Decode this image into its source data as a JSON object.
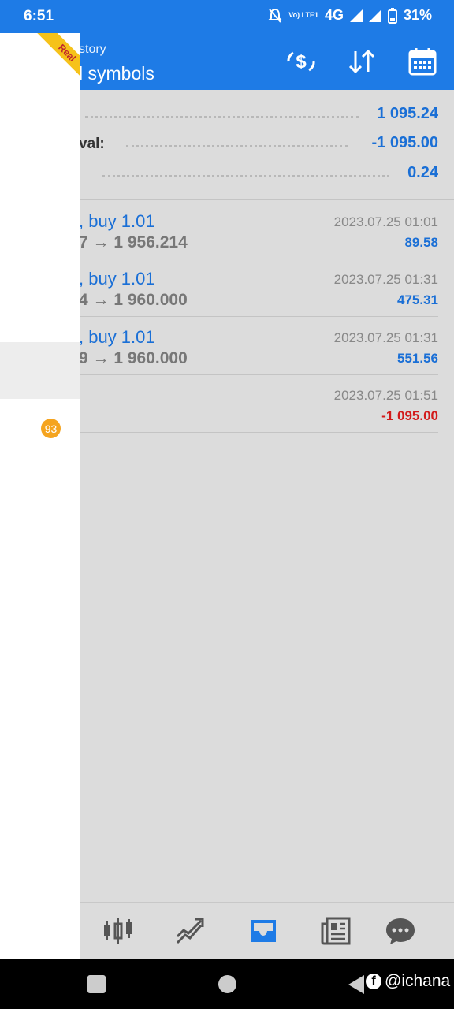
{
  "status_bar": {
    "time": "6:51",
    "network": "4G",
    "battery": "31%",
    "volte": "Vo) LTE1"
  },
  "app_bar": {
    "subtitle": "story",
    "title": "l symbols"
  },
  "summary": [
    {
      "label": "",
      "value": "1 095.24"
    },
    {
      "label": "val:",
      "value": "-1 095.00"
    },
    {
      "label": "",
      "value": "0.24"
    }
  ],
  "deals": [
    {
      "line1": ", buy 1.01",
      "line2": "7 → 1 956.214",
      "date": "2023.07.25 01:01",
      "profit": "89.58",
      "negative": false
    },
    {
      "line1": ", buy 1.01",
      "line2": "4 → 1 960.000",
      "date": "2023.07.25 01:31",
      "profit": "475.31",
      "negative": false
    },
    {
      "line1": ", buy 1.01",
      "line2": "9 → 1 960.000",
      "date": "2023.07.25 01:31",
      "profit": "551.56",
      "negative": false
    },
    {
      "line1": "",
      "line2": "",
      "date": "2023.07.25 01:51",
      "profit": "-1 095.00",
      "negative": true
    }
  ],
  "drawer": {
    "ribbon": "Real",
    "badge": "93"
  },
  "bottom_nav": [
    "quotes-icon",
    "trade-icon",
    "history-icon",
    "news-icon",
    "chat-icon"
  ],
  "watermark": "@ichana",
  "colors": {
    "primary": "#1e7be6",
    "value_blue": "#1a6fd6",
    "negative_red": "#d21b1b",
    "badge": "#f5a41f"
  }
}
